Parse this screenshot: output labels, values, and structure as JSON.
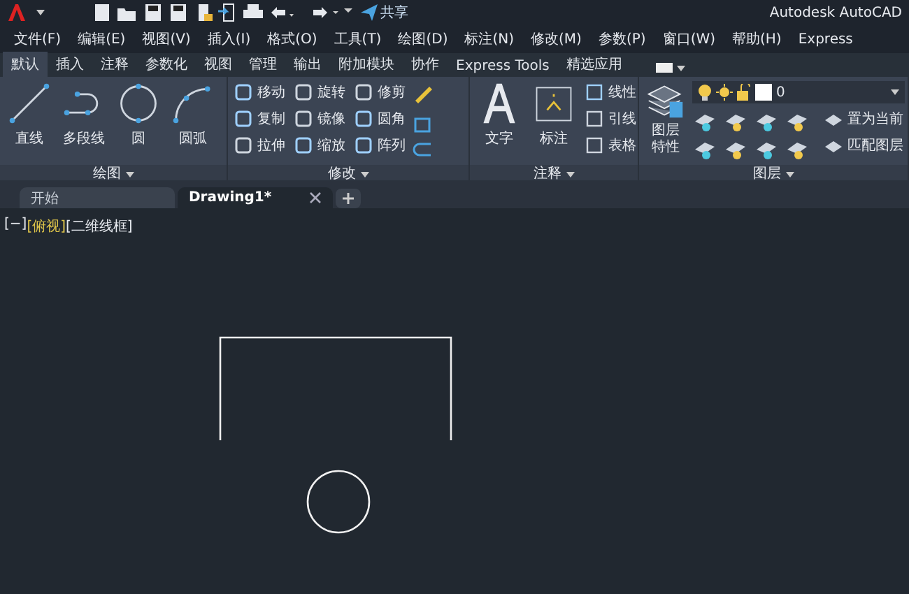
{
  "title_bar": {
    "share_label": "共享",
    "app_title": "Autodesk AutoCAD"
  },
  "menu_bar": [
    "文件(F)",
    "编辑(E)",
    "视图(V)",
    "插入(I)",
    "格式(O)",
    "工具(T)",
    "绘图(D)",
    "标注(N)",
    "修改(M)",
    "参数(P)",
    "窗口(W)",
    "帮助(H)",
    "Express"
  ],
  "ribbon_tabs": [
    {
      "label": "默认",
      "selected": true
    },
    {
      "label": "插入",
      "selected": false
    },
    {
      "label": "注释",
      "selected": false
    },
    {
      "label": "参数化",
      "selected": false
    },
    {
      "label": "视图",
      "selected": false
    },
    {
      "label": "管理",
      "selected": false
    },
    {
      "label": "输出",
      "selected": false
    },
    {
      "label": "附加模块",
      "selected": false
    },
    {
      "label": "协作",
      "selected": false
    },
    {
      "label": "Express Tools",
      "selected": false
    },
    {
      "label": "精选应用",
      "selected": false
    }
  ],
  "ribbon_panels": [
    {
      "kind": "draw",
      "title": "绘图",
      "large_tools": [
        "直线",
        "多段线",
        "圆",
        "圆弧"
      ]
    },
    {
      "kind": "modify",
      "title": "修改",
      "small_tools": [
        "移动",
        "旋转",
        "修剪",
        "复制",
        "镜像",
        "圆角",
        "拉伸",
        "缩放",
        "阵列"
      ]
    },
    {
      "kind": "annotate",
      "title": "注释",
      "large_tools": [
        "文字",
        "标注"
      ],
      "small_tools": [
        "线性",
        "引线",
        "表格"
      ]
    },
    {
      "kind": "layers",
      "title": "图层",
      "large_tools": [
        "图层特性"
      ],
      "small_tools": [
        "置为当前",
        "匹配图层"
      ],
      "layer_value": "0"
    }
  ],
  "file_tabs": [
    {
      "label": "开始",
      "selected": false
    },
    {
      "label": "Drawing1*",
      "selected": true
    }
  ],
  "viewport_controls": [
    {
      "label": "[−]",
      "highlighted": false
    },
    {
      "label": "[俯视]",
      "highlighted": true
    },
    {
      "label": "[二维线框]",
      "highlighted": false
    }
  ]
}
